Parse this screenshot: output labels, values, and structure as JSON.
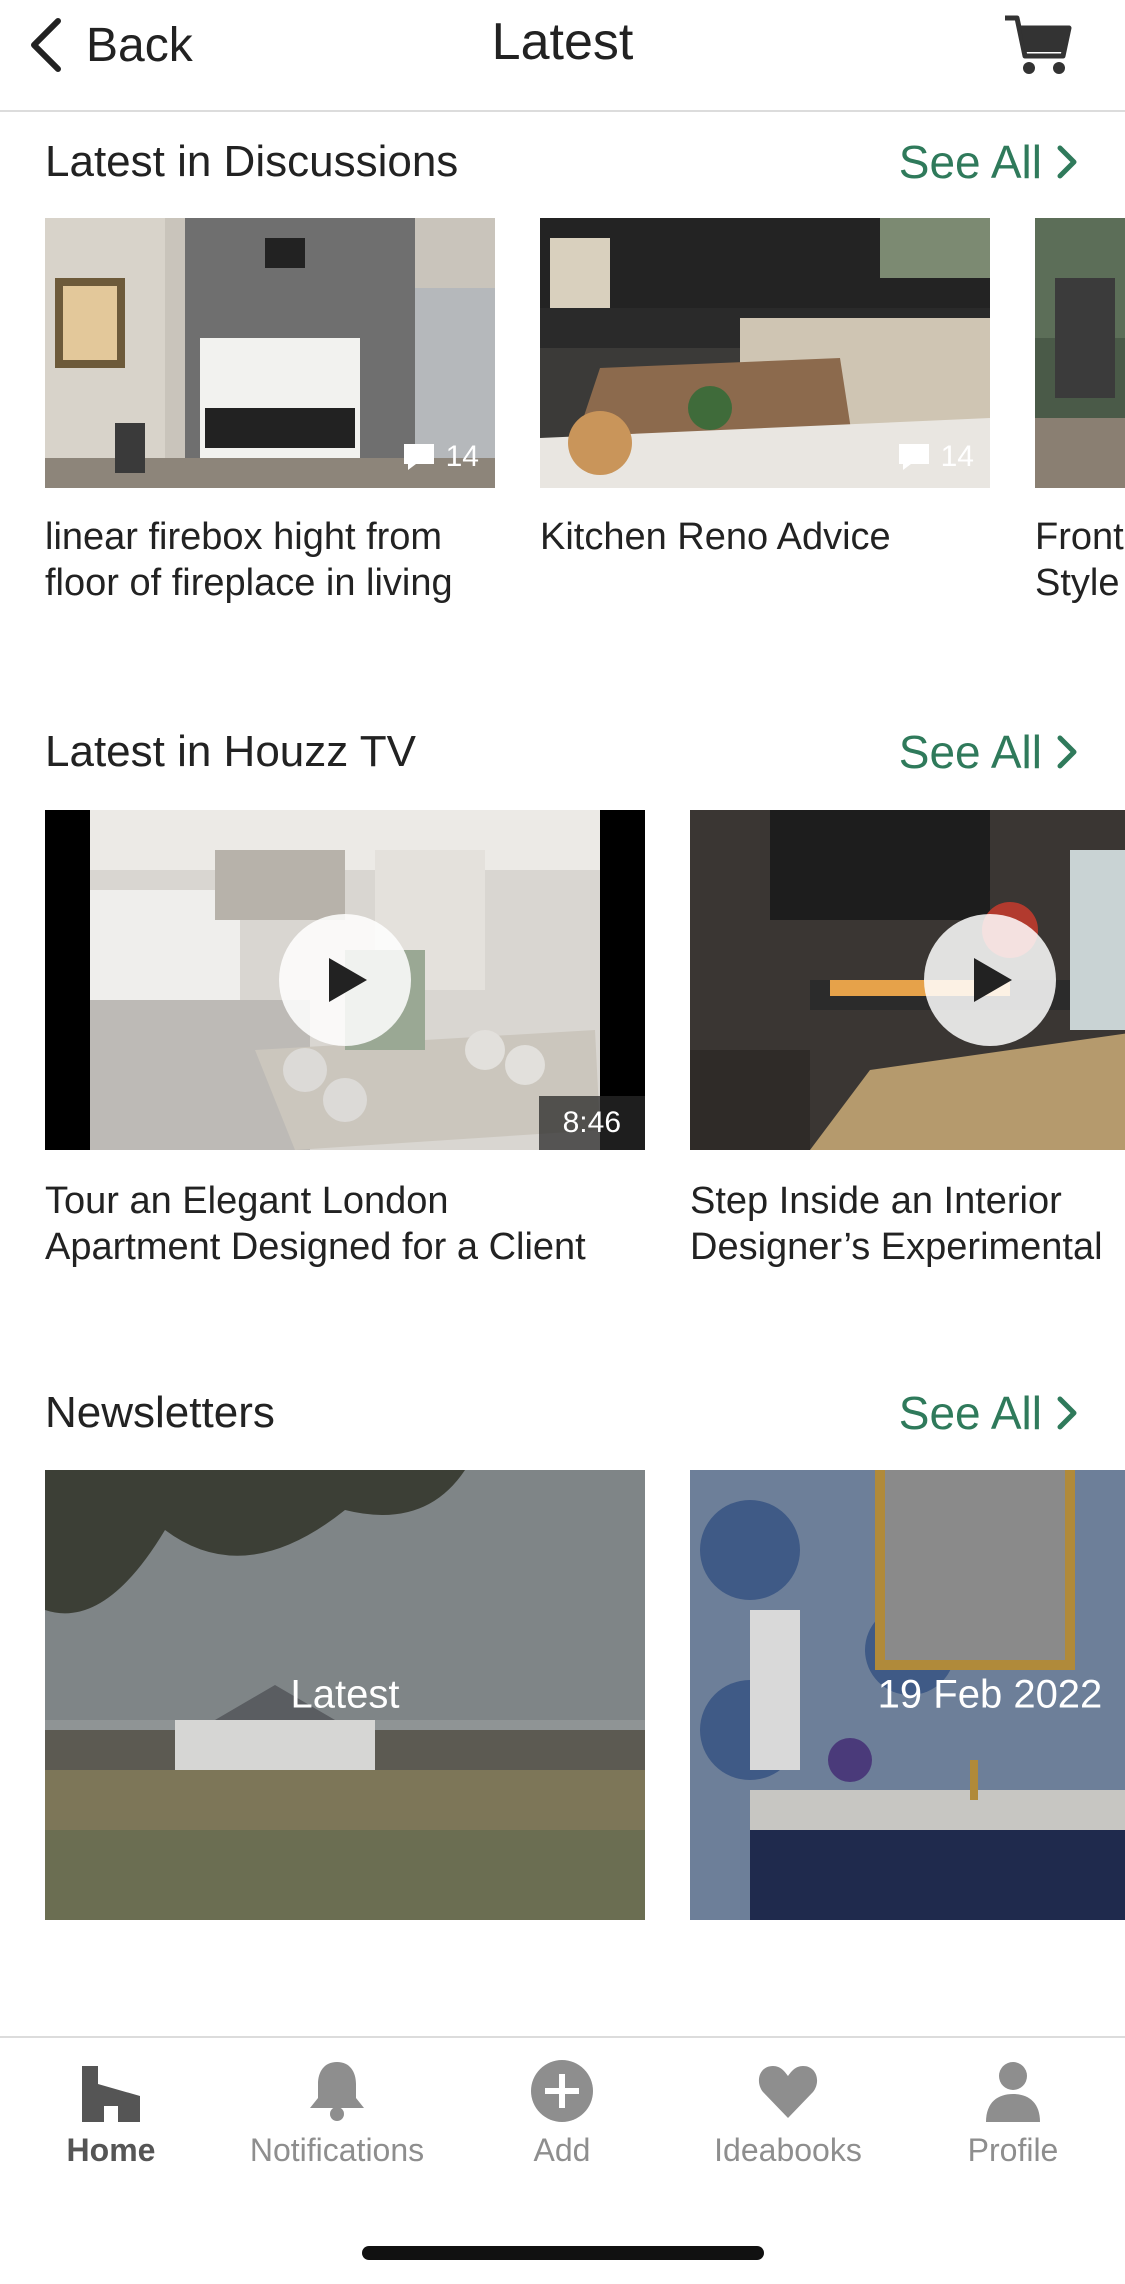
{
  "header": {
    "back_label": "Back",
    "title": "Latest",
    "icons": {
      "back": "chevron-left-icon",
      "cart": "cart-icon"
    }
  },
  "discussions": {
    "title": "Latest in Discussions",
    "see_all": "See All",
    "items": [
      {
        "caption_line1": "linear firebox hight from",
        "caption_line2": "floor of fireplace in living",
        "comments": "14"
      },
      {
        "caption_line1": "Kitchen Reno Advice",
        "caption_line2": "",
        "comments": "14"
      },
      {
        "caption_line1": "Front",
        "caption_line2": "Style",
        "comments": ""
      }
    ]
  },
  "houzz_tv": {
    "title": "Latest in Houzz TV",
    "see_all": "See All",
    "items": [
      {
        "caption_line1": "Tour an Elegant London",
        "caption_line2": "Apartment Designed for a Client",
        "duration": "8:46"
      },
      {
        "caption_line1": "Step Inside an Interior",
        "caption_line2": "Designer’s Experimental",
        "duration": ""
      }
    ]
  },
  "newsletters": {
    "title": "Newsletters",
    "see_all": "See All",
    "items": [
      {
        "label": "Latest"
      },
      {
        "label": "19 Feb 2022"
      }
    ]
  },
  "bottom_nav": {
    "items": [
      {
        "label": "Home",
        "icon": "home-icon",
        "active": true
      },
      {
        "label": "Notifications",
        "icon": "bell-icon",
        "active": false
      },
      {
        "label": "Add",
        "icon": "plus-circle-icon",
        "active": false
      },
      {
        "label": "Ideabooks",
        "icon": "heart-icon",
        "active": false
      },
      {
        "label": "Profile",
        "icon": "person-icon",
        "active": false
      }
    ]
  },
  "colors": {
    "accent": "#2f7a5b",
    "text": "#222222",
    "inactive": "#8e8e8e"
  }
}
